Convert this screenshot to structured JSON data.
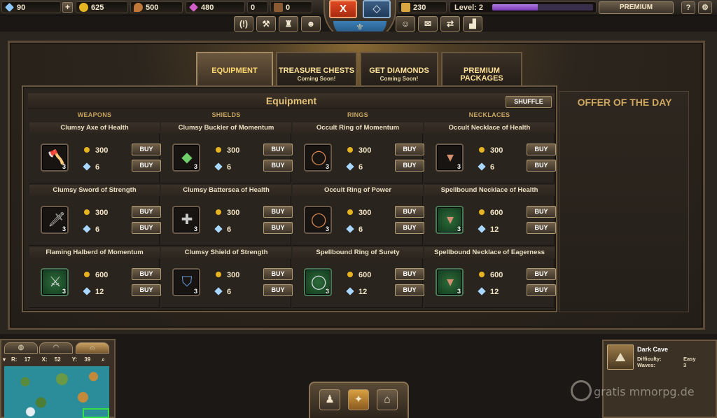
{
  "topbar": {
    "diamonds": "90",
    "gold": "625",
    "food": "500",
    "crystals": "480",
    "stat_a": "0",
    "stat_b": "0",
    "stat_c": "230",
    "level_label": "Level: 2",
    "level_progress": 0.45,
    "premium_label": "PREMIUM",
    "help_label": "?",
    "settings_label": "⚙",
    "close_label": "X"
  },
  "tabs": [
    {
      "label": "EQUIPMENT",
      "sub": ""
    },
    {
      "label": "TREASURE CHESTS",
      "sub": "Coming Soon!"
    },
    {
      "label": "GET DIAMONDS",
      "sub": "Coming Soon!"
    },
    {
      "label": "PREMIUM PACKAGES",
      "sub": ""
    }
  ],
  "shop": {
    "title": "Equipment",
    "shuffle_label": "SHUFFLE",
    "buy_label": "BUY",
    "columns": [
      "WEAPONS",
      "SHIELDS",
      "RINGS",
      "NECKLACES"
    ],
    "items": [
      [
        {
          "name": "Clumsy Axe of Health",
          "qty": "3",
          "gold": "300",
          "diamonds": "6",
          "icon": "axe-icon"
        },
        {
          "name": "Clumsy Sword of Strength",
          "qty": "3",
          "gold": "300",
          "diamonds": "6",
          "icon": "sword-icon"
        },
        {
          "name": "Flaming Halberd of Momentum",
          "qty": "3",
          "gold": "600",
          "diamonds": "12",
          "icon": "halberd-icon"
        }
      ],
      [
        {
          "name": "Clumsy Buckler of Momentum",
          "qty": "3",
          "gold": "300",
          "diamonds": "6",
          "icon": "buckler-icon"
        },
        {
          "name": "Clumsy Battersea of Health",
          "qty": "3",
          "gold": "300",
          "diamonds": "6",
          "icon": "battersea-icon"
        },
        {
          "name": "Clumsy Shield of Strength",
          "qty": "3",
          "gold": "300",
          "diamonds": "6",
          "icon": "shield-icon"
        }
      ],
      [
        {
          "name": "Occult Ring of Momentum",
          "qty": "3",
          "gold": "300",
          "diamonds": "6",
          "icon": "ring-icon"
        },
        {
          "name": "Occult Ring of Power",
          "qty": "3",
          "gold": "300",
          "diamonds": "6",
          "icon": "ring-icon"
        },
        {
          "name": "Spellbound Ring of Surety",
          "qty": "3",
          "gold": "600",
          "diamonds": "12",
          "icon": "silver-ring-icon"
        }
      ],
      [
        {
          "name": "Occult Necklace of Health",
          "qty": "3",
          "gold": "300",
          "diamonds": "6",
          "icon": "necklace-icon"
        },
        {
          "name": "Spellbound Necklace of Health",
          "qty": "3",
          "gold": "600",
          "diamonds": "12",
          "icon": "necklace-icon"
        },
        {
          "name": "Spellbound Necklace of Eagerness",
          "qty": "3",
          "gold": "600",
          "diamonds": "12",
          "icon": "necklace-icon"
        }
      ]
    ]
  },
  "offer": {
    "title": "OFFER OF THE DAY"
  },
  "minimap": {
    "r_label": "R:",
    "r_value": "17",
    "x_label": "X:",
    "x_value": "52",
    "y_label": "Y:",
    "y_value": "39"
  },
  "cave": {
    "name": "Dark Cave",
    "difficulty_label": "Difficulty:",
    "difficulty_value": "Easy",
    "waves_label": "Waves:",
    "waves_value": "3"
  },
  "watermark": "gratis mmorpg.de"
}
